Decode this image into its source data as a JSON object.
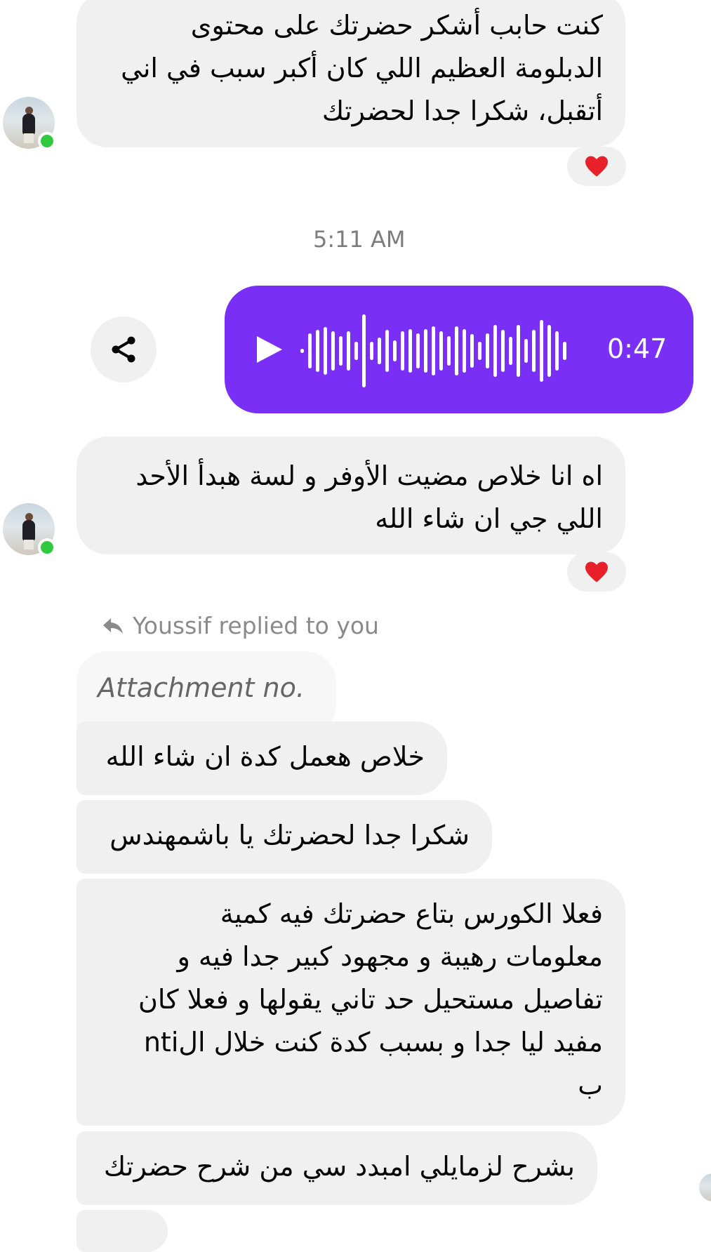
{
  "messages": {
    "m1": "كنت حابب أشكر حضرتك على محتوى الدبلومة العظيم اللي كان أكبر سبب في اني أتقبل، شكرا جدا لحضرتك",
    "m1_lines": [
      "كنت حابب أشكر حضرتك على محتوى",
      "الدبلومة العظيم اللي كان أكبر سبب في اني",
      "أتقبل، شكرا جدا لحضرتك"
    ],
    "timestamp": "5:11 AM",
    "voice_duration": "0:47",
    "m2_lines": [
      "اه انا خلاص مضيت الأوفر و لسة هبدأ الأحد",
      "اللي جي ان شاء الله"
    ],
    "reply_note": "Youssif replied to you",
    "reply_quote": "Attachment no.",
    "m3": "خلاص هعمل كدة ان شاء الله",
    "m4": "شكرا جدا لحضرتك يا باشمهندس",
    "m5_lines": [
      "فعلا الكورس بتاع حضرتك فيه كمية",
      "معلومات رهيبة و مجهود كبير جدا فيه و",
      "تفاصيل مستحيل حد تاني يقولها و فعلا كان",
      "مفيد ليا جدا و بسبب كدة كنت خلال الnti",
      "ب"
    ],
    "m6": "بشرح لزمايلي امبدد سي من شرح حضرتك"
  },
  "colors": {
    "bubble_incoming": "#f0f0f0",
    "bubble_outgoing": "#7a2ff7",
    "online": "#31c940",
    "heart": "#e8202a"
  },
  "icons": {
    "reaction": "heart-icon",
    "share": "share-icon",
    "play": "play-icon",
    "reply": "reply-arrow-icon"
  }
}
